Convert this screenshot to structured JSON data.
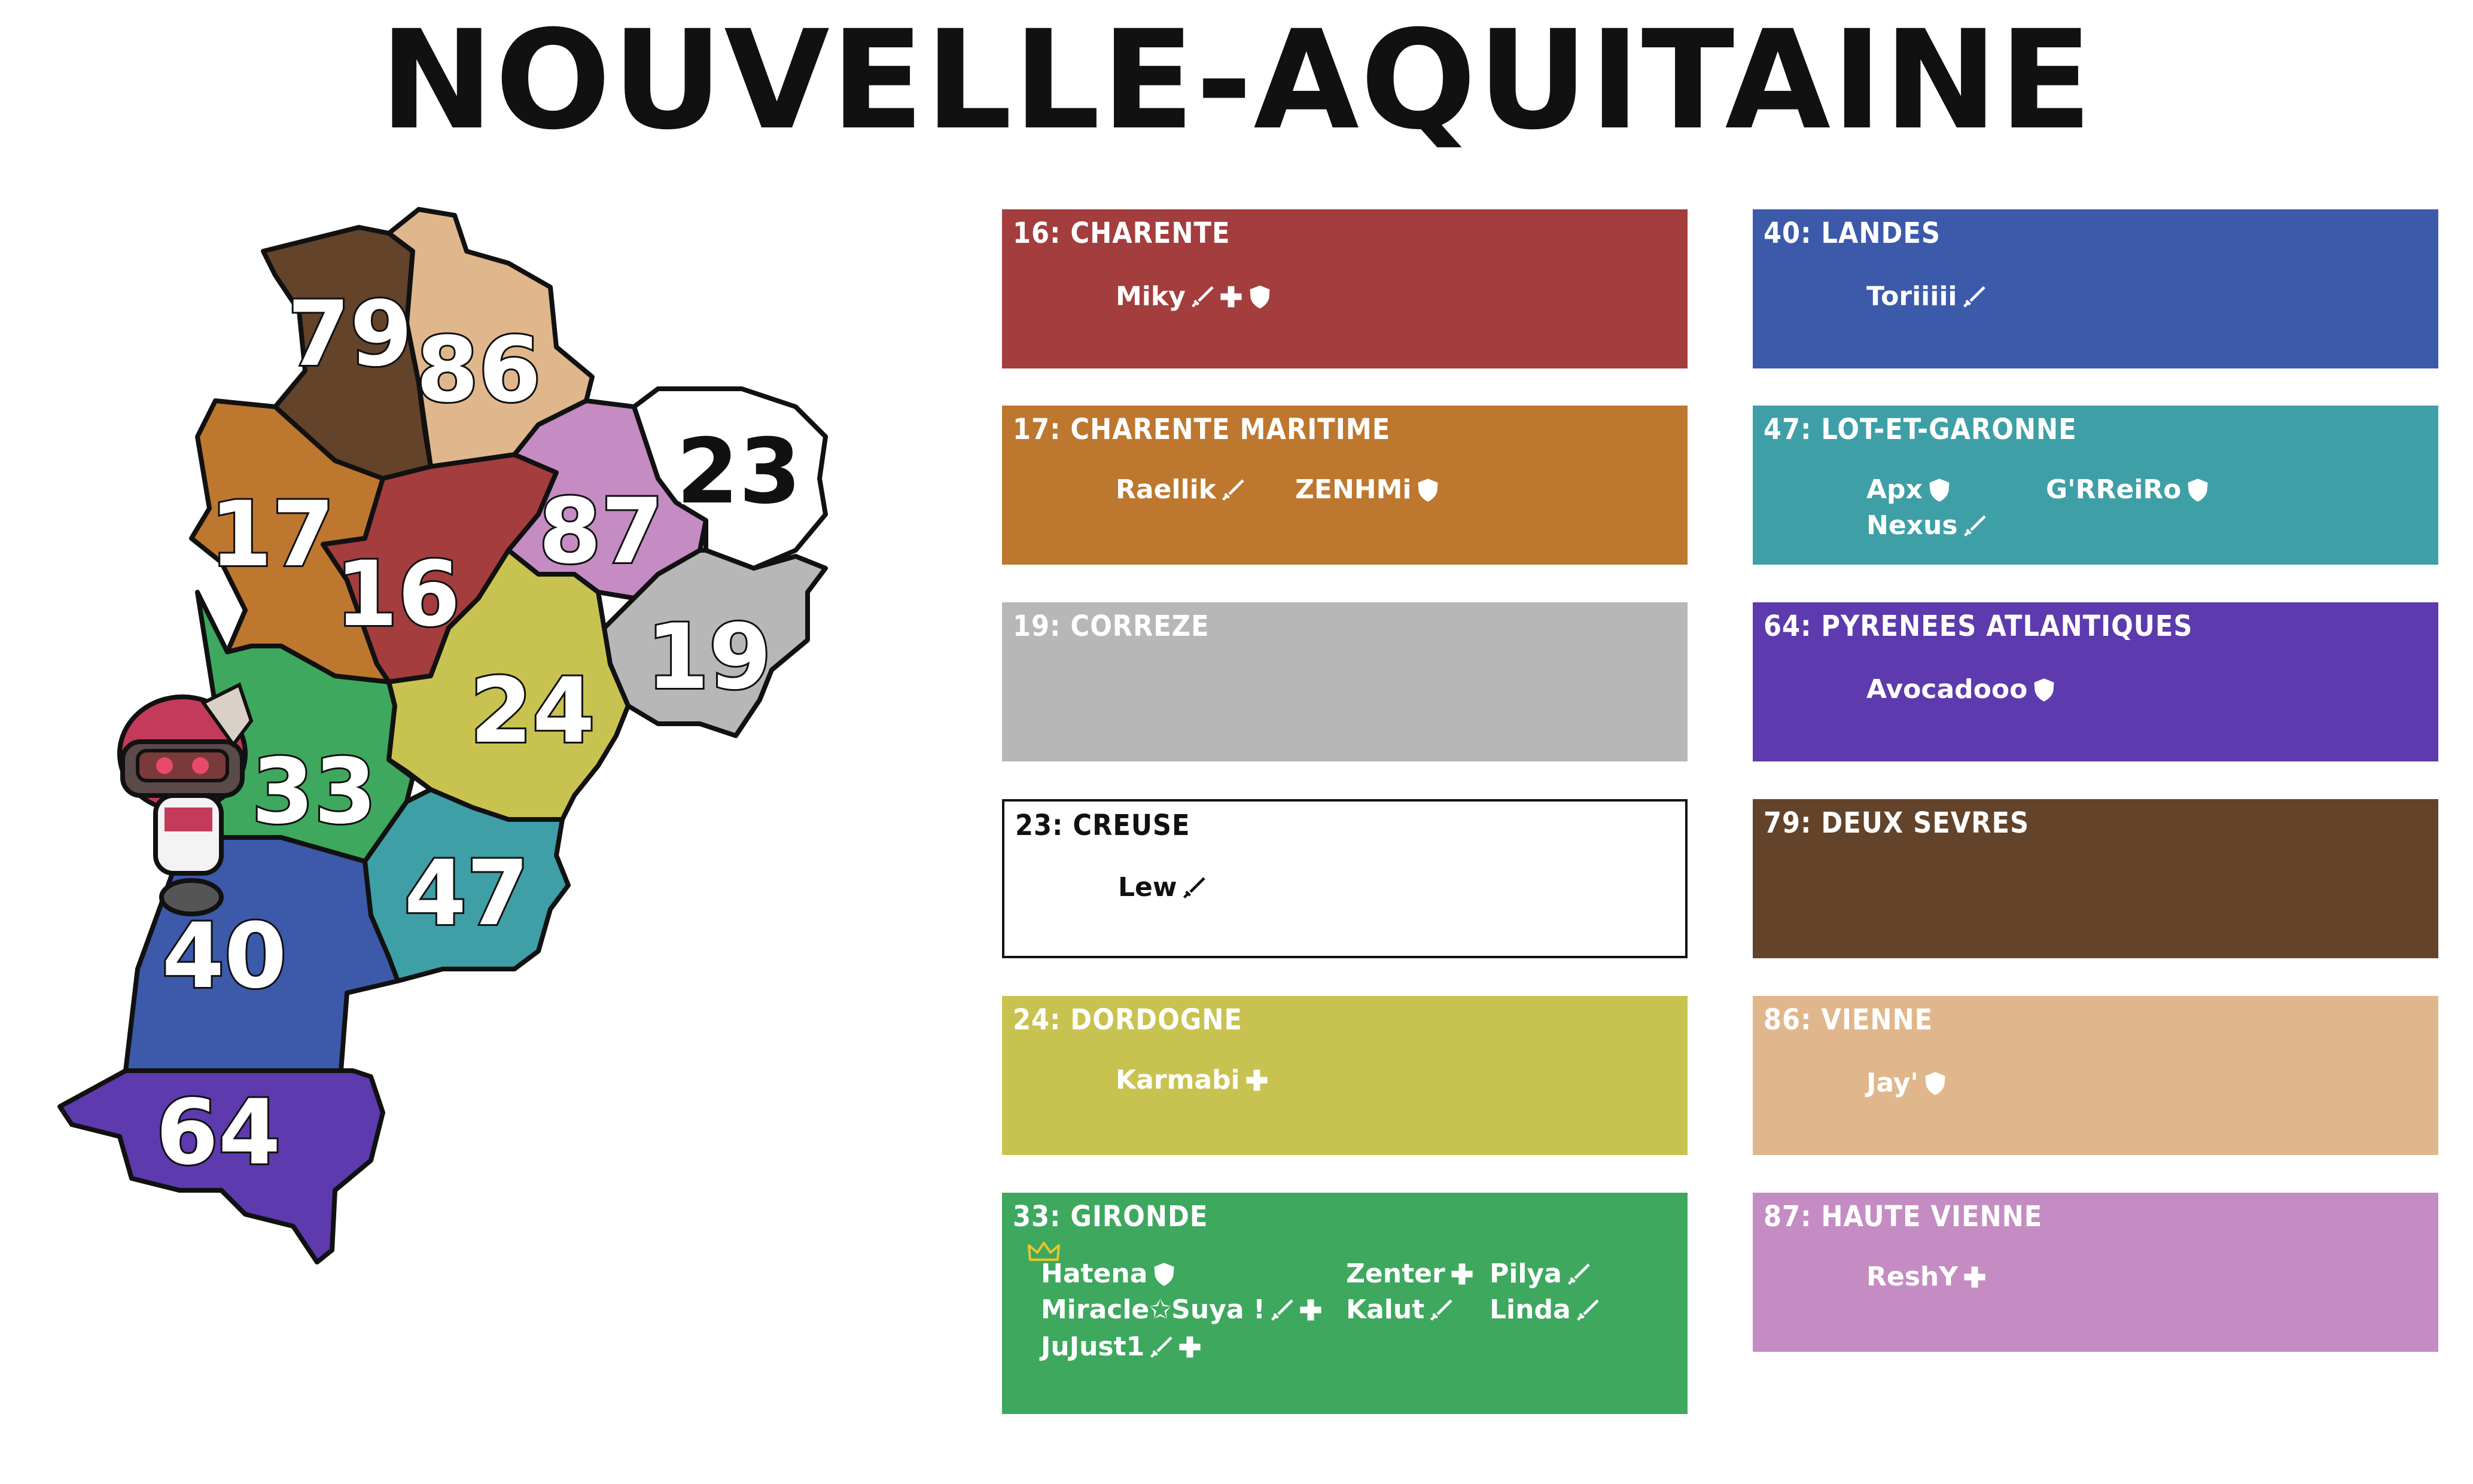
{
  "title": "NOUVELLE-AQUITAINE",
  "map": {
    "regions": [
      {
        "code": "79",
        "label": "79",
        "color": "#63432a"
      },
      {
        "code": "86",
        "label": "86",
        "color": "#e0b78c"
      },
      {
        "code": "17",
        "label": "17",
        "color": "#bd772e"
      },
      {
        "code": "16",
        "label": "16",
        "color": "#a43d3d"
      },
      {
        "code": "87",
        "label": "87",
        "color": "#c48cc2"
      },
      {
        "code": "23",
        "label": "23",
        "color": "#ffffff"
      },
      {
        "code": "19",
        "label": "19",
        "color": "#b7b7b7"
      },
      {
        "code": "24",
        "label": "24",
        "color": "#c8c350"
      },
      {
        "code": "33",
        "label": "33",
        "color": "#3ea85e"
      },
      {
        "code": "47",
        "label": "47",
        "color": "#3f9fa6"
      },
      {
        "code": "40",
        "label": "40",
        "color": "#3c5aa9"
      },
      {
        "code": "64",
        "label": "64",
        "color": "#5d3aad"
      }
    ]
  },
  "departments": [
    {
      "title": "16: CHARENTE",
      "color": "#a43d3d",
      "light": false,
      "members": [
        {
          "name": "Miky",
          "roles": [
            "sword-icon",
            "plus-icon",
            "shield-icon"
          ]
        }
      ]
    },
    {
      "title": "17: CHARENTE MARITIME",
      "color": "#bd772e",
      "light": false,
      "members": [
        {
          "name": "Raellik",
          "roles": [
            "sword-icon"
          ]
        },
        {
          "name": "ZENHMi",
          "roles": [
            "shield-icon"
          ]
        }
      ]
    },
    {
      "title": "19: CORREZE",
      "color": "#b7b7b7",
      "light": false,
      "members": []
    },
    {
      "title": "23: CREUSE",
      "color": "#ffffff",
      "light": true,
      "members": [
        {
          "name": "Lew",
          "roles": [
            "sword-icon"
          ]
        }
      ]
    },
    {
      "title": "24: DORDOGNE",
      "color": "#c8c350",
      "light": false,
      "members": [
        {
          "name": "Karmabi",
          "roles": [
            "plus-icon"
          ]
        }
      ]
    },
    {
      "title": "33: GIRONDE",
      "color": "#3ea85e",
      "light": false,
      "members": [
        {
          "name": "Hatena",
          "roles": [
            "shield-icon"
          ],
          "leader": true
        },
        {
          "name": "Miracle✩Suya !",
          "roles": [
            "sword-icon",
            "plus-icon"
          ]
        },
        {
          "name": "JuJust1",
          "roles": [
            "sword-icon",
            "plus-icon"
          ]
        },
        {
          "name": "Zenter",
          "roles": [
            "plus-icon"
          ]
        },
        {
          "name": "Kalut",
          "roles": [
            "sword-icon"
          ]
        },
        {
          "name": "Pilya",
          "roles": [
            "sword-icon"
          ]
        },
        {
          "name": "Linda",
          "roles": [
            "sword-icon"
          ]
        }
      ]
    },
    {
      "title": "40: LANDES",
      "color": "#3c5aa9",
      "light": false,
      "members": [
        {
          "name": "Toriiiii",
          "roles": [
            "sword-icon"
          ]
        }
      ]
    },
    {
      "title": "47: LOT-ET-GARONNE",
      "color": "#3f9fa6",
      "light": false,
      "members": [
        {
          "name": "Apx",
          "roles": [
            "shield-icon"
          ]
        },
        {
          "name": "G'RReiRo",
          "roles": [
            "shield-icon"
          ]
        },
        {
          "name": "Nexus",
          "roles": [
            "sword-icon"
          ]
        }
      ]
    },
    {
      "title": "64: PYRENEES ATLANTIQUES",
      "color": "#5d3aad",
      "light": false,
      "members": [
        {
          "name": "Avocadooo",
          "roles": [
            "shield-icon"
          ]
        }
      ]
    },
    {
      "title": "79: DEUX SEVRES",
      "color": "#63432a",
      "light": false,
      "members": []
    },
    {
      "title": "86: VIENNE",
      "color": "#e0b78c",
      "light": false,
      "members": [
        {
          "name": "Jay'",
          "roles": [
            "shield-icon"
          ]
        }
      ]
    },
    {
      "title": "87: HAUTE VIENNE",
      "color": "#c48cc2",
      "light": false,
      "members": [
        {
          "name": "ReshY",
          "roles": [
            "plus-icon"
          ]
        }
      ]
    }
  ]
}
